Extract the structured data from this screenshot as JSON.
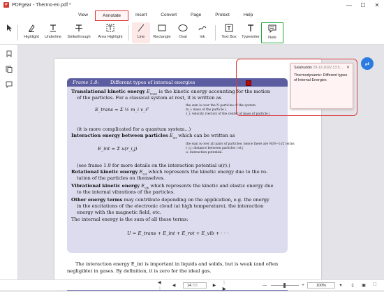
{
  "window": {
    "title": "PDFgear - Thermo-en.pdf *",
    "logo": "P"
  },
  "menu": [
    "View",
    "Annotate",
    "Insert",
    "Convert",
    "Page",
    "Protect",
    "Help"
  ],
  "toolbar": {
    "highlight": "Highlight",
    "underline": "Underline",
    "strikethrough": "Strikethrough",
    "area_highlight": "Area Highlight",
    "line": "Line",
    "rectangle": "Rectangle",
    "oval": "Oval",
    "ink": "Ink",
    "text_box": "Text Box",
    "typewriter": "Typewriter",
    "note": "Note"
  },
  "document": {
    "frame_num": "Frame 1.8:",
    "frame_title": "Different types of internal energies",
    "l1a": "Translational kinetic energy",
    "l1b": "is the kinetic energy accounting for the motion",
    "l2": "of the particles. For a classical system at rest, it is written as",
    "eq1": "E_trans = Σ ½ m_i v_i²",
    "eq1_note1": "the sum is over the N particles of the system",
    "eq1_note2": "m_i: mass of the particle i,",
    "eq1_note3": "v_i: velocity (vector) of the center of mass of particle i",
    "l3": "(it is more complicated for a quantum system...)",
    "l4a": "Interaction energy between particles",
    "l4b": "which can be written as",
    "eq2": "E_int = Σ u(r_i,j)",
    "eq2_note1": "the sum is over all pairs of particles; hence there are N(N−1)/2 terms",
    "eq2_note2": "r_i,j: distance between particles i et j",
    "eq2_note3": "u: interaction potential.",
    "l5": "(see frame 1.9 for more details on the interaction potential u(r).)",
    "l6a": "Rotational kinetic energy",
    "l6b": "which represents the kinetic energy due to the ro-",
    "l7": "tation of the particles on themselves.",
    "l8a": "Vibrational kinetic energy",
    "l8b": "which represents the kinetic and elastic energy due",
    "l9": "to the internal vibrations of the particles.",
    "l10a": "Other energy terms",
    "l10b": "may contribute depending on the application, e.g. the energy",
    "l11": "in the excitations of the electronic cloud (at high temperature), the interaction",
    "l12": "energy with the magnetic field, etc.",
    "l13": "The internal energy is the sum of all these terms:",
    "eq3": "U = E_trans + E_int + E_rot + E_vib + · · ·",
    "p1": "The interaction energy E_int is important in liquids and solids, but is weak (and often",
    "p2": "negligible) in gases. By definition, it is zero for the ideal gas."
  },
  "note": {
    "author": "Salahuddin",
    "date": "29-12-2022 13:5...",
    "text": "Thermodynamic: Different types of Internal Energies"
  },
  "status": {
    "page_current": "14",
    "page_total": "/55",
    "zoom": "100%"
  },
  "colors": {
    "accent": "#d93535",
    "frame_header": "#5b5da0",
    "highlight_box": "#23a53a"
  }
}
